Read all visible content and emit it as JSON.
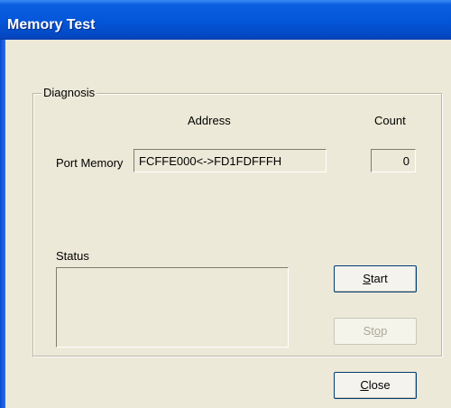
{
  "window": {
    "title": "Memory Test"
  },
  "diagnosis": {
    "group_label": "Diagnosis",
    "address_header": "Address",
    "count_header": "Count",
    "row_label": "Port Memory",
    "address_value": "FCFFE000<->FD1FDFFFH",
    "count_value": "0",
    "status_label": "Status",
    "status_value": ""
  },
  "buttons": {
    "start": {
      "pre": "",
      "mnemonic": "S",
      "post": "tart"
    },
    "stop": {
      "pre": "St",
      "mnemonic": "o",
      "post": "p"
    },
    "close": {
      "pre": "",
      "mnemonic": "C",
      "post": "lose"
    }
  }
}
